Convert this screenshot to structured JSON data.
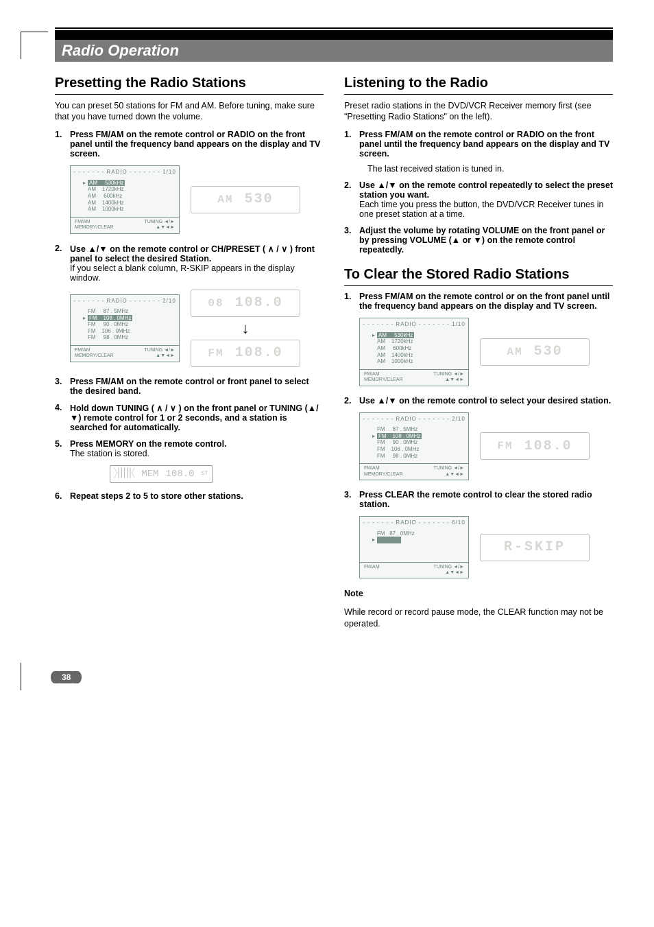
{
  "page_number": "38",
  "bar_title": "Radio Operation",
  "left": {
    "h": "Presetting the Radio Stations",
    "intro": "You can preset 50 stations for FM and AM. Before tuning, make sure that you have turned down the volume.",
    "steps": {
      "s1": "Press FM/AM on the remote control or RADIO on the front panel until the frequency band appears on the display and TV screen.",
      "s2a": "Use ▲/▼ on the remote control or CH/PRESET ( ∧ / ∨ )  front panel to select the desired Station.",
      "s2b": "If you select a blank column, R-SKIP appears in the display window.",
      "s3": "Press FM/AM on the remote control or front panel to select the desired band.",
      "s4": "Hold down TUNING ( ∧ / ∨ ) on the front panel or TUNING (▲/▼) remote control for 1 or 2 seconds, and a station is searched for automatically.",
      "s5a": "Press MEMORY on the remote control.",
      "s5b": "The station is stored.",
      "s6": "Repeat steps 2 to 5 to store other stations."
    }
  },
  "right": {
    "h1": "Listening to the Radio",
    "p1": "Preset radio stations in the DVD/VCR Receiver memory first (see \"Presetting Radio Stations\" on the left).",
    "steps1": {
      "s1": "Press FM/AM on the remote control or RADIO on the front panel until the frequency band appears on the display and TV screen.",
      "s1b": "The last received station is tuned in.",
      "s2a": "Use ▲/▼ on the remote control repeatedly to select the preset station you want.",
      "s2b": "Each time you press the button, the DVD/VCR Receiver tunes in one preset station at a time.",
      "s3": "Adjust the volume by rotating VOLUME on the front panel or by pressing VOLUME (▲ or ▼) on the remote control repeatedly."
    },
    "h2": "To Clear the Stored Radio Stations",
    "steps2": {
      "s1": "Press FM/AM on the remote control or on the front panel until the frequency band appears on the display and TV screen.",
      "s2": "Use ▲/▼ on the remote control to select your desired station.",
      "s3": "Press CLEAR the remote control to clear the stored radio station."
    },
    "noteh": "Note",
    "note": "While record or record pause mode, the CLEAR function may not be operated."
  },
  "osd": {
    "title": "- - - - - - - RADIO - - - - - - -",
    "page1": "1/10",
    "page2": "2/10",
    "page6": "6/10",
    "am_rows": [
      "AM     530kHz",
      "AM    1720kHz",
      "AM     600kHz",
      "AM    1400kHz",
      "AM    1000kHz"
    ],
    "fm_rows": [
      "FM     87 . 5MHz",
      "FM    108 . 0MHz",
      "FM     90 . 0MHz",
      "FM    106 . 0MHz",
      "FM     98 . 0MHz"
    ],
    "fm6": "FM   87 . 0MHz",
    "foot_l1": "FM/AM",
    "foot_l2": "MEMORY/CLEAR",
    "foot_r": "TUNING ◄/►"
  },
  "lcd": {
    "am": "AM",
    "am_v": "530",
    "fm": "FM",
    "fm_v": "108.0",
    "ch": "08",
    "ch_v": "108.0",
    "mem": "MEM",
    "mem_v": "108.0",
    "rskip": "R-SKIP"
  }
}
